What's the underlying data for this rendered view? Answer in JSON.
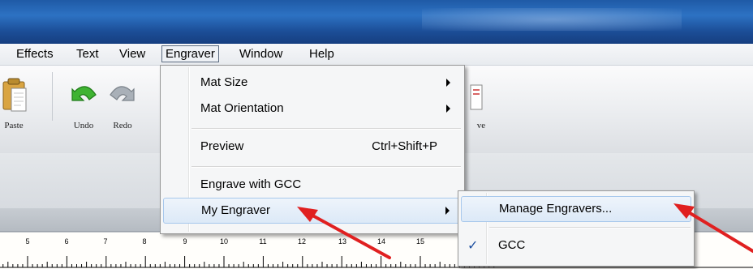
{
  "menubar": {
    "items": [
      {
        "label": "Effects"
      },
      {
        "label": "Text"
      },
      {
        "label": "View"
      },
      {
        "label": "Engraver",
        "active": true
      },
      {
        "label": "Window"
      },
      {
        "label": "Help"
      }
    ]
  },
  "toolbar": {
    "paste_label": "Paste",
    "undo_label": "Undo",
    "redo_label": "Redo",
    "partial_label": "ve"
  },
  "engraver_menu": {
    "items": [
      {
        "label": "Mat Size",
        "submenu": true
      },
      {
        "label": "Mat Orientation",
        "submenu": true
      },
      {
        "label": "Preview",
        "shortcut": "Ctrl+Shift+P"
      },
      {
        "label": "Engrave with GCC"
      },
      {
        "label": "My Engraver",
        "submenu": true,
        "highlighted": true
      }
    ]
  },
  "my_engraver_submenu": {
    "items": [
      {
        "label": "Manage Engravers...",
        "highlighted": true
      },
      {
        "label": "GCC",
        "checked": true
      }
    ],
    "check_glyph": "✓"
  },
  "ruler": {
    "labels": [
      "5",
      "6",
      "7",
      "8",
      "9",
      "10",
      "11",
      "12",
      "13",
      "14",
      "15"
    ]
  },
  "colors": {
    "annotation_arrow": "#e02020",
    "titlebar": "#1f5aa6",
    "menu_highlight": "#dce9f7"
  }
}
